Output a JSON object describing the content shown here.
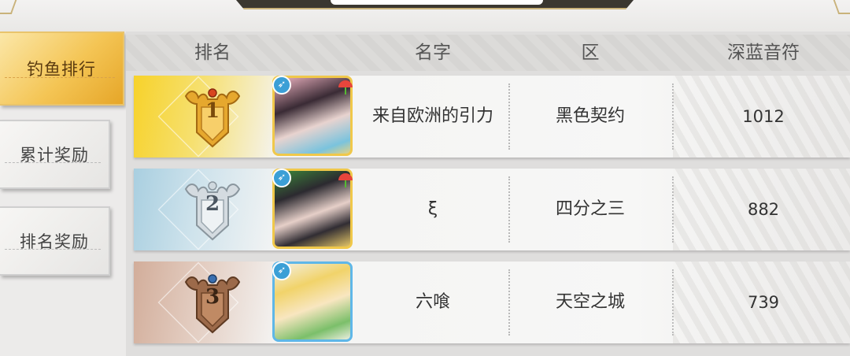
{
  "tabs": [
    {
      "label": "钓鱼排行",
      "active": true
    },
    {
      "label": "累计奖励",
      "active": false
    },
    {
      "label": "排名奖励",
      "active": false
    }
  ],
  "table": {
    "headers": {
      "rank": "排名",
      "name": "名字",
      "zone": "区",
      "score": "深蓝音符"
    },
    "rows": [
      {
        "rank": "1",
        "name": "来自欧洲的引力",
        "zone": "黑色契约",
        "score": "1012",
        "medal": "gold-antler-crest-icon"
      },
      {
        "rank": "2",
        "name": "ξ",
        "zone": "四分之三",
        "score": "882",
        "medal": "silver-antler-crest-icon"
      },
      {
        "rank": "3",
        "name": "六喰",
        "zone": "天空之城",
        "score": "739",
        "medal": "bronze-antler-crest-icon"
      }
    ]
  },
  "colors": {
    "gold": "#f4c555",
    "silver": "#a9cfe0",
    "bronze": "#d2ad9a",
    "accent_blue": "#3b9fd6"
  }
}
